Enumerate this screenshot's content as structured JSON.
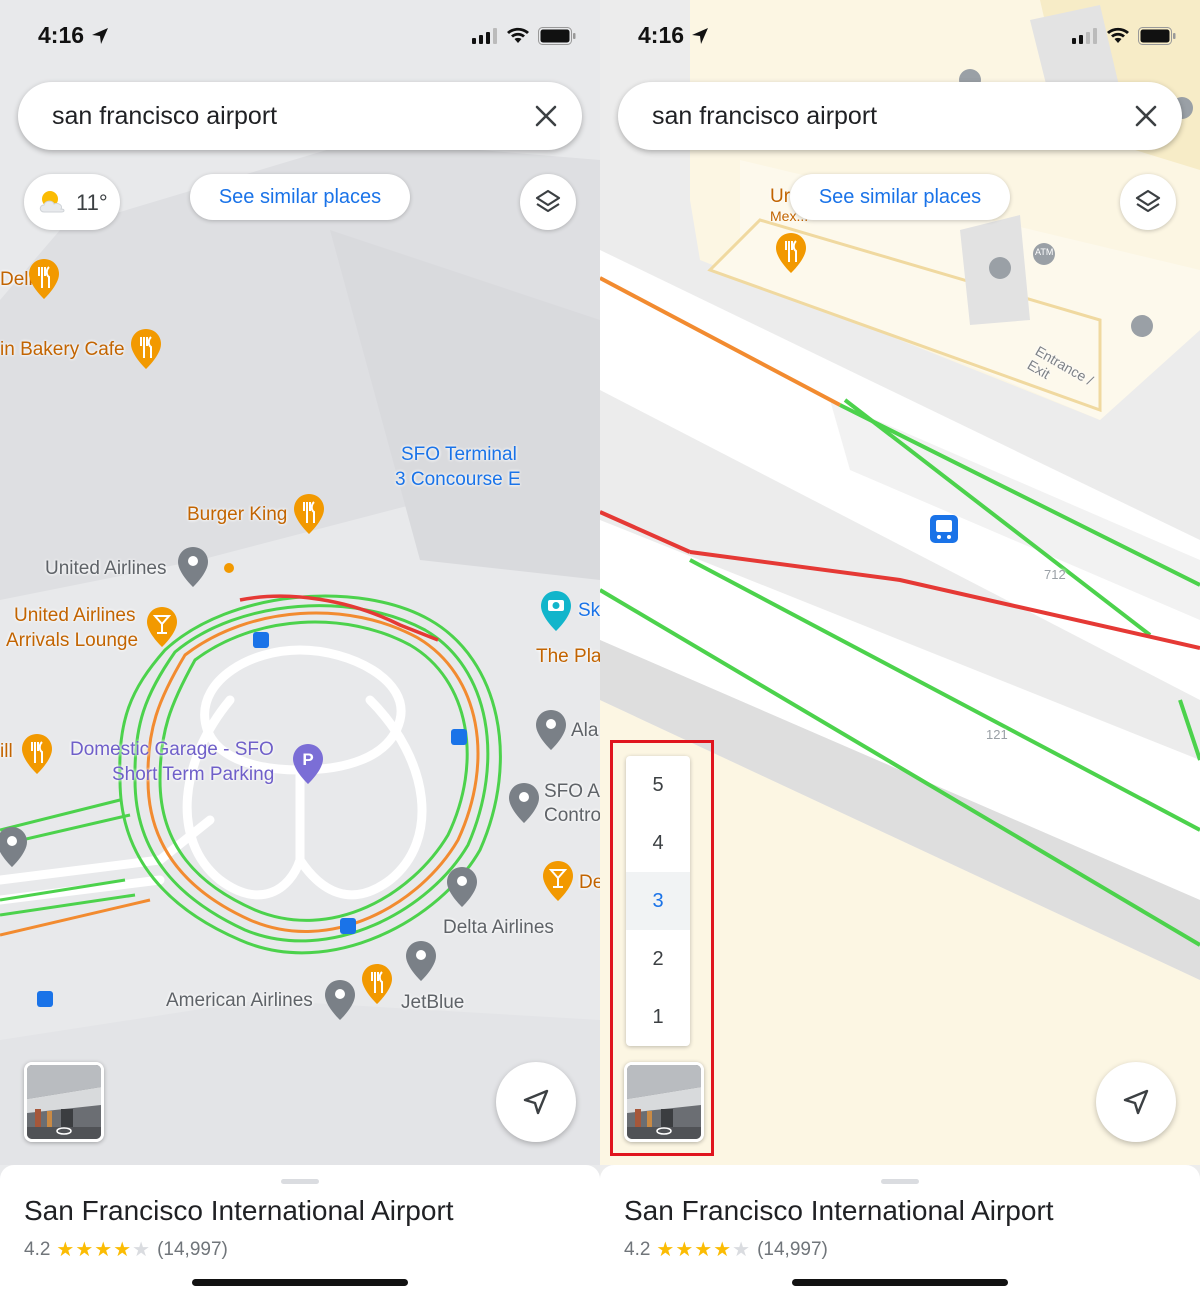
{
  "status_bar": {
    "time": "4:16"
  },
  "search": {
    "query": "san francisco airport"
  },
  "weather": {
    "temp": "11°"
  },
  "chips": {
    "similar": "See similar places"
  },
  "sheet": {
    "name": "San Francisco International Airport",
    "rating": "4.2",
    "stars": "★★★★",
    "empty_star": "★",
    "reviews": "(14,997)"
  },
  "left_map": {
    "labels": {
      "deli": "Deli",
      "bakery": "in Bakery Cafe",
      "terminal1": "SFO Terminal",
      "terminal2": "3 Concourse E",
      "burger": "Burger King",
      "united": "United Airlines",
      "lounge1": "United Airlines",
      "lounge2": "Arrivals Lounge",
      "sky": "Sk",
      "theplace": "The Pla",
      "alaska": "Ala",
      "grill": "ill",
      "garage1": "Domestic Garage - SFO",
      "garage2": "Short Term Parking",
      "control1": "SFO A",
      "control2": "Contro",
      "de": "De",
      "delta": "Delta Airlines",
      "american": "American Airlines",
      "jetblue": "JetBlue"
    }
  },
  "right_map": {
    "labels": {
      "ur": "Ur",
      "mex": "Mex...",
      "entrance": "Entrance / Exit",
      "atm": "ATM",
      "road712": "712",
      "road121": "121"
    },
    "floors": [
      "5",
      "4",
      "3",
      "2",
      "1"
    ],
    "active_floor": "3"
  },
  "colors": {
    "accent": "#1a73e8",
    "traffic_green": "#4cd24c",
    "traffic_orange": "#f28b30",
    "traffic_red": "#e53935",
    "food_pin": "#f29900",
    "highlight_box": "#e0141e"
  }
}
